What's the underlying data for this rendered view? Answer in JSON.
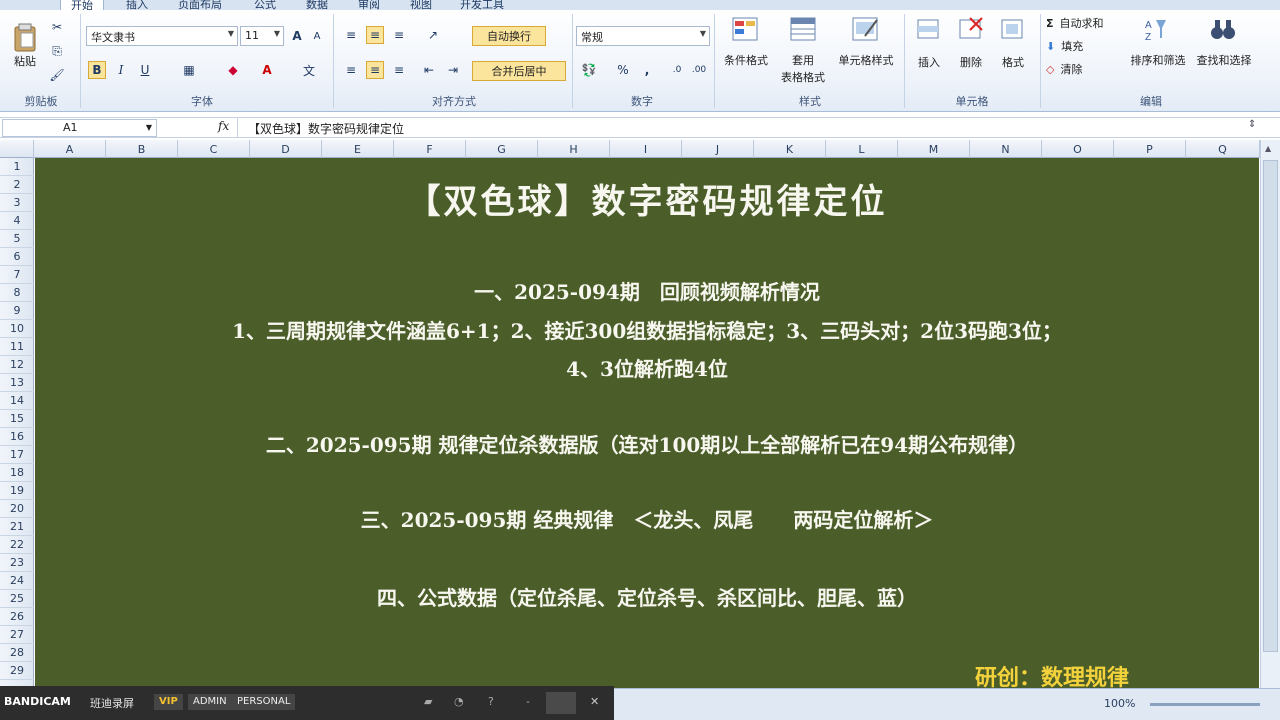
{
  "tabs": [
    "开始",
    "插入",
    "页面布局",
    "公式",
    "数据",
    "审阅",
    "视图",
    "开发工具"
  ],
  "clipboard": {
    "paste_label": "粘贴",
    "group_label": "剪贴板"
  },
  "font": {
    "family": "华文隶书",
    "size": "11",
    "bold": "B",
    "italic": "I",
    "underline": "U",
    "group_label": "字体"
  },
  "alignment": {
    "wrap_label": "自动换行",
    "merge_label": "合并后居中",
    "group_label": "对齐方式"
  },
  "number": {
    "format": "常规",
    "percent": "%",
    "comma": ",",
    "group_label": "数字"
  },
  "styles": {
    "conditional": "条件格式",
    "table_format_1": "套用",
    "table_format_2": "表格格式",
    "cell_styles": "单元格样式",
    "group_label": "样式"
  },
  "cells": {
    "insert": "插入",
    "delete": "删除",
    "format": "格式",
    "group_label": "单元格"
  },
  "editing": {
    "autosum": "自动求和",
    "fill": "填充",
    "clear": "清除",
    "sort": "排序和筛选",
    "find": "查找和选择",
    "group_label": "编辑"
  },
  "formula_bar": {
    "cell_ref": "A1",
    "fx": "fx",
    "content": "【双色球】数字密码规律定位"
  },
  "columns": [
    "A",
    "B",
    "C",
    "D",
    "E",
    "F",
    "G",
    "H",
    "I",
    "J",
    "K",
    "L",
    "M",
    "N",
    "O",
    "P",
    "Q"
  ],
  "rows": [
    "1",
    "2",
    "3",
    "4",
    "5",
    "6",
    "7",
    "8",
    "9",
    "10",
    "11",
    "12",
    "13",
    "14",
    "15",
    "16",
    "17",
    "18",
    "19",
    "20",
    "21",
    "22",
    "23",
    "24",
    "25",
    "26",
    "27",
    "28",
    "29"
  ],
  "content": {
    "title": "【双色球】数字密码规律定位",
    "s1_heading": "一、2025-094期　回顾视频解析情况",
    "s1_line1": "1、三周期规律文件涵盖6+1；2、接近300组数据指标稳定；3、三码头对；2位3码跑3位；",
    "s1_line2": "4、3位解析跑4位",
    "s2": "二、2025-095期 规律定位杀数据版（连对100期以上全部解析已在94期公布规律）",
    "s3": "三、2025-095期 经典规律　＜龙头、凤尾　　两码定位解析＞",
    "s4": "四、公式数据（定位杀尾、定位杀号、杀区间比、胆尾、蓝）",
    "author": "研创：数理规律"
  },
  "recorder": {
    "brand": "BANDICAM",
    "name": "班迪录屏",
    "vip": "VIP",
    "admin": "ADMIN",
    "personal": "PERSONAL",
    "help": "?",
    "minus": "-",
    "close": "✕"
  },
  "status": {
    "zoom": "100%"
  },
  "colors": {
    "sheet_bg": "#4b5e2a",
    "text": "#f7f7f0",
    "author": "#f4d23c"
  }
}
